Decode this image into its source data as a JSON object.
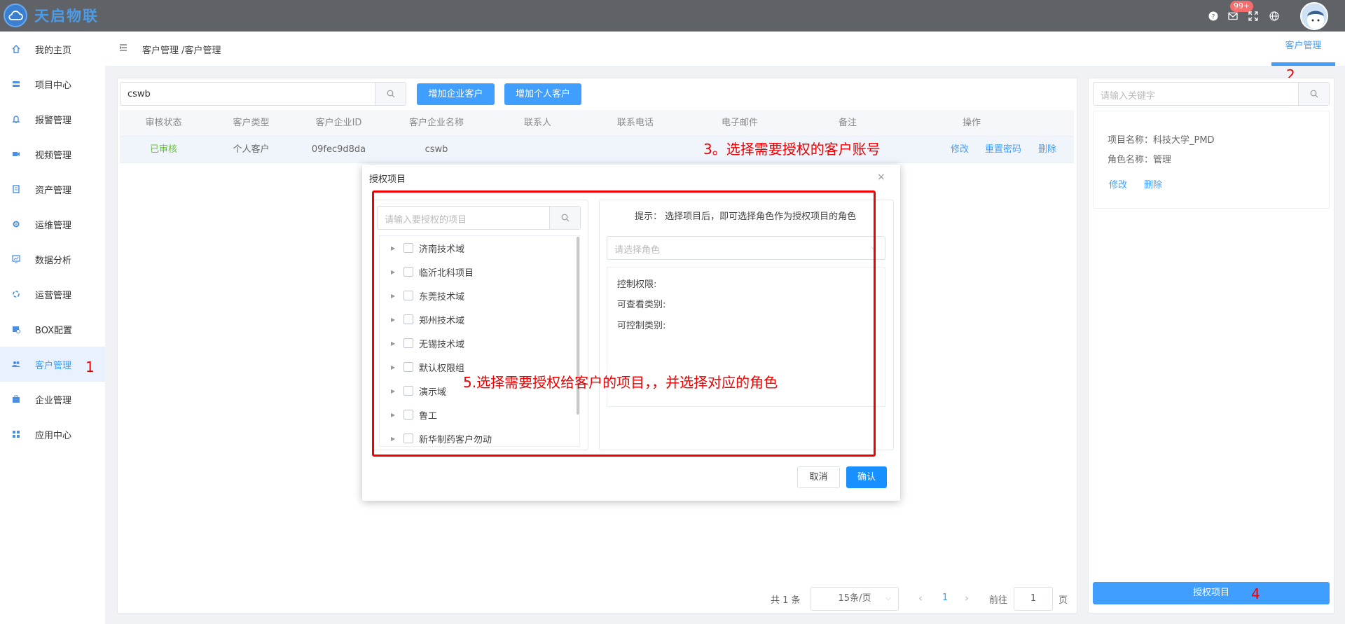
{
  "app": {
    "title": "天启物联",
    "notifications_badge": "99+"
  },
  "sidebar": {
    "items": [
      {
        "label": "我的主页",
        "icon": "home-icon"
      },
      {
        "label": "项目中心",
        "icon": "project-icon"
      },
      {
        "label": "报警管理",
        "icon": "bell-icon"
      },
      {
        "label": "视频管理",
        "icon": "video-icon"
      },
      {
        "label": "资产管理",
        "icon": "asset-icon"
      },
      {
        "label": "运维管理",
        "icon": "gear-icon"
      },
      {
        "label": "数据分析",
        "icon": "chart-icon"
      },
      {
        "label": "运营管理",
        "icon": "operations-icon"
      },
      {
        "label": "BOX配置",
        "icon": "box-config-icon"
      },
      {
        "label": "客户管理",
        "icon": "users-icon",
        "active": true
      },
      {
        "label": "企业管理",
        "icon": "briefcase-icon"
      },
      {
        "label": "应用中心",
        "icon": "apps-icon"
      }
    ]
  },
  "breadcrumb": "客户管理 /客户管理",
  "top_tab": "客户管理",
  "toolbar": {
    "search_value": "cswb",
    "add_company_label": "增加企业客户",
    "add_person_label": "增加个人客户"
  },
  "table": {
    "headers": [
      "审核状态",
      "客户类型",
      "客户企业ID",
      "客户企业名称",
      "联系人",
      "联系电话",
      "电子邮件",
      "备注",
      "操作"
    ],
    "rows": [
      {
        "status": "已审核",
        "type": "个人客户",
        "id": "09fec9d8da",
        "name": "cswb",
        "contact": "",
        "phone": "",
        "email": "",
        "remark": "",
        "ops": [
          "修改",
          "重置密码",
          "删除"
        ]
      }
    ]
  },
  "pagination": {
    "total": "共 1 条",
    "page_size": "15条/页",
    "prev": "‹",
    "current": "1",
    "next": "›",
    "goto_label": "前往",
    "goto_value": "1",
    "page_suffix": "页"
  },
  "right_panel": {
    "search_placeholder": "请输入关键字",
    "card": {
      "project_line": "项目名称：科技大学_PMD",
      "role_line": "角色名称：管理",
      "edit": "修改",
      "delete": "删除"
    },
    "grant_button": "授权项目"
  },
  "dialog": {
    "title": "授权项目",
    "close": "×",
    "project_search_placeholder": "请输入要授权的项目",
    "projects": [
      "济南技术域",
      "临沂北科项目",
      "东莞技术域",
      "郑州技术域",
      "无锡技术域",
      "默认权限组",
      "演示域",
      "鲁工",
      "新华制药客户勿动"
    ],
    "hint": "提示： 选择项目后，即可选择角色作为授权项目的角色",
    "role_placeholder": "请选择角色",
    "perm_control": "控制权限:",
    "perm_view": "可查看类别:",
    "perm_controllable": "可控制类别:",
    "cancel": "取消",
    "confirm": "确认"
  },
  "annotations": {
    "a1": "1",
    "a2": "2",
    "a3": "3。选择需要授权的客户账号",
    "a4": "4",
    "a5": "5.选择需要授权给客户的项目，，并选择对应的角色"
  },
  "colors": {
    "accent": "#409eff",
    "annotation": "#ee0000",
    "topbar": "#5f6368",
    "approved": "#67c23a"
  }
}
